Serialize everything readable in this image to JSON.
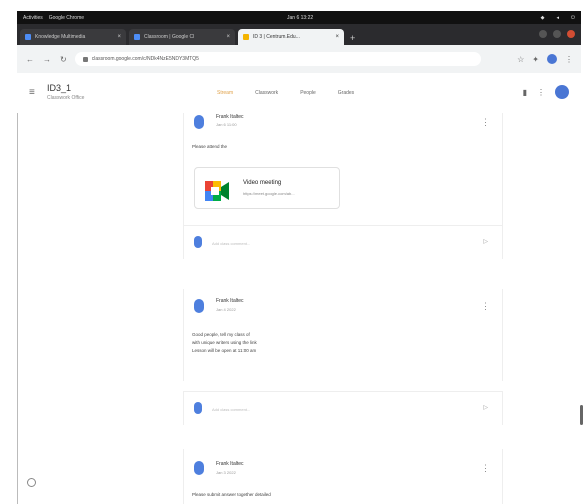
{
  "os": {
    "activities": "Activities",
    "app": "Google Chrome",
    "clock": "Jan 6 13:22"
  },
  "browser": {
    "tabs": [
      {
        "label": "Knowledge Multimedia"
      },
      {
        "label": "Classroom | Google Cl"
      },
      {
        "label": "ID 3 | Centrum.Edu..."
      }
    ],
    "new_tab": "+",
    "url": "classroom.google.com/c/NDk4NzE5NDY3MTQ5"
  },
  "app": {
    "title": "ID3_1",
    "subtitle": "Classwork Office",
    "tabs": [
      "Stream",
      "Classwork",
      "People",
      "Grades"
    ],
    "active_tab": "Stream"
  },
  "stream": {
    "posts": [
      {
        "author": "Frank Italtec",
        "time": "Jan 6 11:00",
        "text": [
          "Please attend the"
        ],
        "attachment": {
          "title": "Video meeting",
          "link": "https://meet.google.com/ab..."
        }
      },
      {
        "author": "Frank Italtec",
        "time": "Jan 4 2022",
        "text": [
          "Good people, tell my class of",
          "with unique writers using the link",
          "Lesson will be open at 11:00 am"
        ]
      },
      {
        "author": "Frank Italtec",
        "time": "Jan 3 2022",
        "text": [
          "Please submit answer together detailed"
        ]
      }
    ],
    "comment_placeholder": "Add class comment..."
  }
}
